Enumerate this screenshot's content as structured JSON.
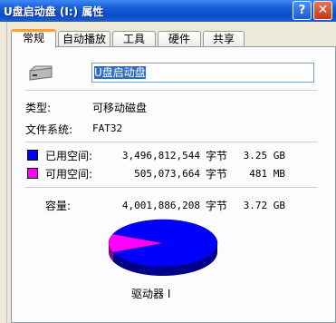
{
  "window": {
    "title": "U盘启动盘 (I:) 属性",
    "help": "?",
    "close": "✕"
  },
  "tabs": [
    "常规",
    "自动播放",
    "工具",
    "硬件",
    "共享"
  ],
  "general": {
    "volume_name": "U盘启动盘",
    "type_label": "类型:",
    "type_value": "可移动磁盘",
    "fs_label": "文件系统:",
    "fs_value": "FAT32",
    "used": {
      "label": "已用空间:",
      "bytes": "3,496,812,544",
      "unit": "字节",
      "size": "3.25 GB",
      "color": "#0000ff"
    },
    "free": {
      "label": "可用空间:",
      "bytes": "505,073,664",
      "unit": "字节",
      "size": "481 MB",
      "color": "#ff00ff"
    },
    "capacity": {
      "label": "容量:",
      "bytes": "4,001,886,208",
      "unit": "字节",
      "size": "3.72 GB"
    },
    "drive_label": "驱动器 I"
  },
  "colors": {
    "used": "#0000ff",
    "free": "#ff00ff",
    "title_bar": "#0a4cc9"
  },
  "pie": {
    "used_fraction": 0.874,
    "free_fraction": 0.126
  }
}
